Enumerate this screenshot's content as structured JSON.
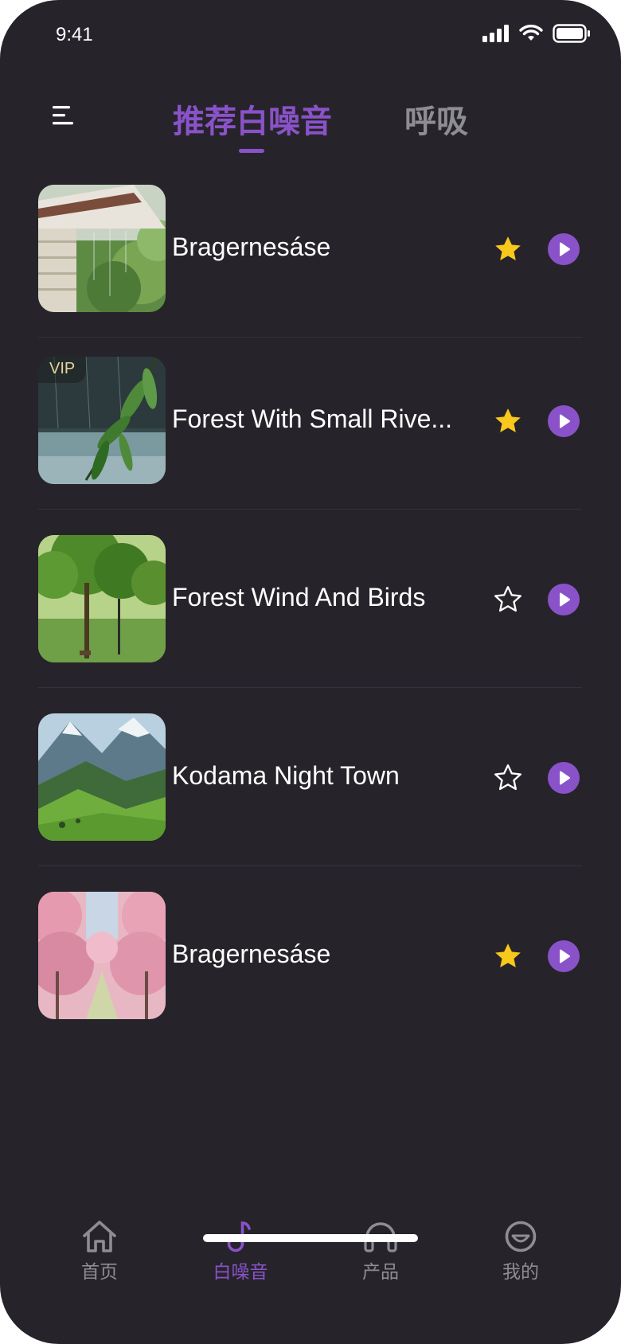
{
  "status_bar": {
    "time": "9:41"
  },
  "header": {
    "tabs": [
      {
        "label": "推荐白噪音",
        "active": true
      },
      {
        "label": "呼吸",
        "active": false
      }
    ]
  },
  "tracks": [
    {
      "title": "Bragernesáse",
      "favorited": true,
      "vip": false,
      "thumb": "rain-eaves"
    },
    {
      "title": "Forest With Small River Birds",
      "display_title": "Forest With Small Rive...",
      "favorited": true,
      "vip": true,
      "vip_label": "VIP",
      "thumb": "rain-leaves"
    },
    {
      "title": "Forest Wind And Birds",
      "favorited": false,
      "vip": false,
      "thumb": "park-trees"
    },
    {
      "title": "Kodama Night Town",
      "favorited": false,
      "vip": false,
      "thumb": "green-mountains"
    },
    {
      "title": "Bragernesáse",
      "favorited": true,
      "vip": false,
      "thumb": "cherry-blossom"
    }
  ],
  "tabbar": {
    "items": [
      {
        "label": "首页",
        "icon": "home-icon",
        "active": false
      },
      {
        "label": "白噪音",
        "icon": "music-note-icon",
        "active": true
      },
      {
        "label": "产品",
        "icon": "headphones-icon",
        "active": false
      },
      {
        "label": "我的",
        "icon": "smile-icon",
        "active": false
      }
    ]
  },
  "colors": {
    "background": "#26242a",
    "accent": "#8a52c9",
    "star": "#f8c81c",
    "inactive": "#8e8d92"
  }
}
